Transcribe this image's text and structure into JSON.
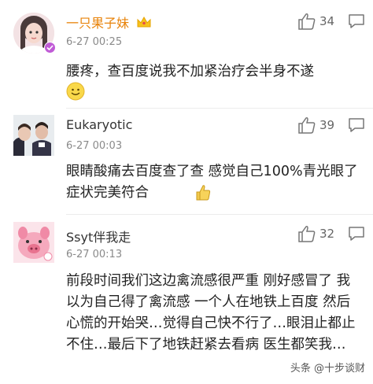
{
  "comments": [
    {
      "username": "一只果子妹",
      "time": "6-27 00:25",
      "text": "腰疼，查百度说我不加紧治疗会半身不遂",
      "likes": "34",
      "username_color": "#e8830a",
      "badge": "crown-icon",
      "end_emoji": "smile-emoji"
    },
    {
      "username": "Eukaryotic",
      "time": "6-27 00:03",
      "text": "眼睛酸痛去百度查了查 感觉自己100%青光眼了 症状完美符合",
      "likes": "39",
      "end_emoji": "thumbs-up-emoji"
    },
    {
      "username": "Ssyt伴我走",
      "time": "6-27 00:13",
      "text": "前段时间我们这边禽流感很严重 刚好感冒了 我以为自己得了禽流感 一个人在地铁上百度 然后心慌的开始哭…觉得自己快不行了…眼泪止都止不住…最后下了地铁赶紧去看病 医生都笑我…",
      "likes": "32"
    }
  ],
  "watermark": {
    "text": "头条 @十步谈财"
  }
}
